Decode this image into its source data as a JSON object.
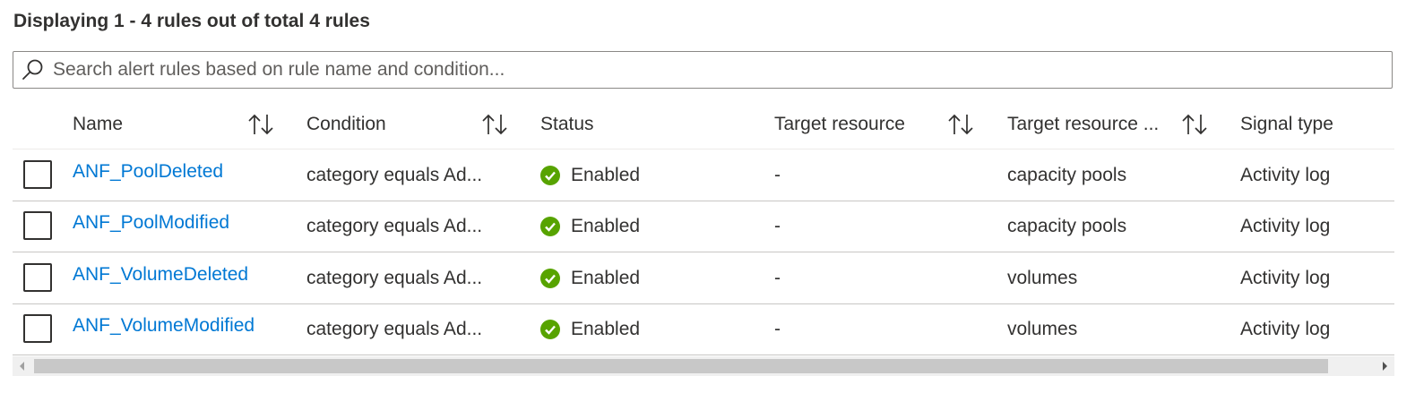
{
  "summary": "Displaying 1 - 4 rules out of total 4 rules",
  "search": {
    "placeholder": "Search alert rules based on rule name and condition..."
  },
  "columns": [
    {
      "label": "Name",
      "sortable": true
    },
    {
      "label": "Condition",
      "sortable": true
    },
    {
      "label": "Status",
      "sortable": false
    },
    {
      "label": "Target resource",
      "sortable": true
    },
    {
      "label": "Target resource ...",
      "sortable": true
    },
    {
      "label": "Signal type",
      "sortable": false
    }
  ],
  "rows": [
    {
      "name": "ANF_PoolDeleted",
      "condition": "category equals Ad...",
      "status": "Enabled",
      "target_resource": "-",
      "target_resource_type": "capacity pools",
      "signal_type": "Activity log",
      "selected": false
    },
    {
      "name": "ANF_PoolModified",
      "condition": "category equals Ad...",
      "status": "Enabled",
      "target_resource": "-",
      "target_resource_type": "capacity pools",
      "signal_type": "Activity log",
      "selected": false
    },
    {
      "name": "ANF_VolumeDeleted",
      "condition": "category equals Ad...",
      "status": "Enabled",
      "target_resource": "-",
      "target_resource_type": "volumes",
      "signal_type": "Activity log",
      "selected": false
    },
    {
      "name": "ANF_VolumeModified",
      "condition": "category equals Ad...",
      "status": "Enabled",
      "target_resource": "-",
      "target_resource_type": "volumes",
      "signal_type": "Activity log",
      "selected": false
    }
  ],
  "icons": {
    "search": "search-icon",
    "sort": "sort-icon",
    "status": "check-circle-icon",
    "scroll_left": "scroll-left-arrow-icon",
    "scroll_right": "scroll-right-arrow-icon"
  },
  "colors": {
    "link": "#0078d4",
    "status_enabled": "#57a300",
    "border": "#8a8886",
    "row_divider": "#c8c6c4"
  }
}
